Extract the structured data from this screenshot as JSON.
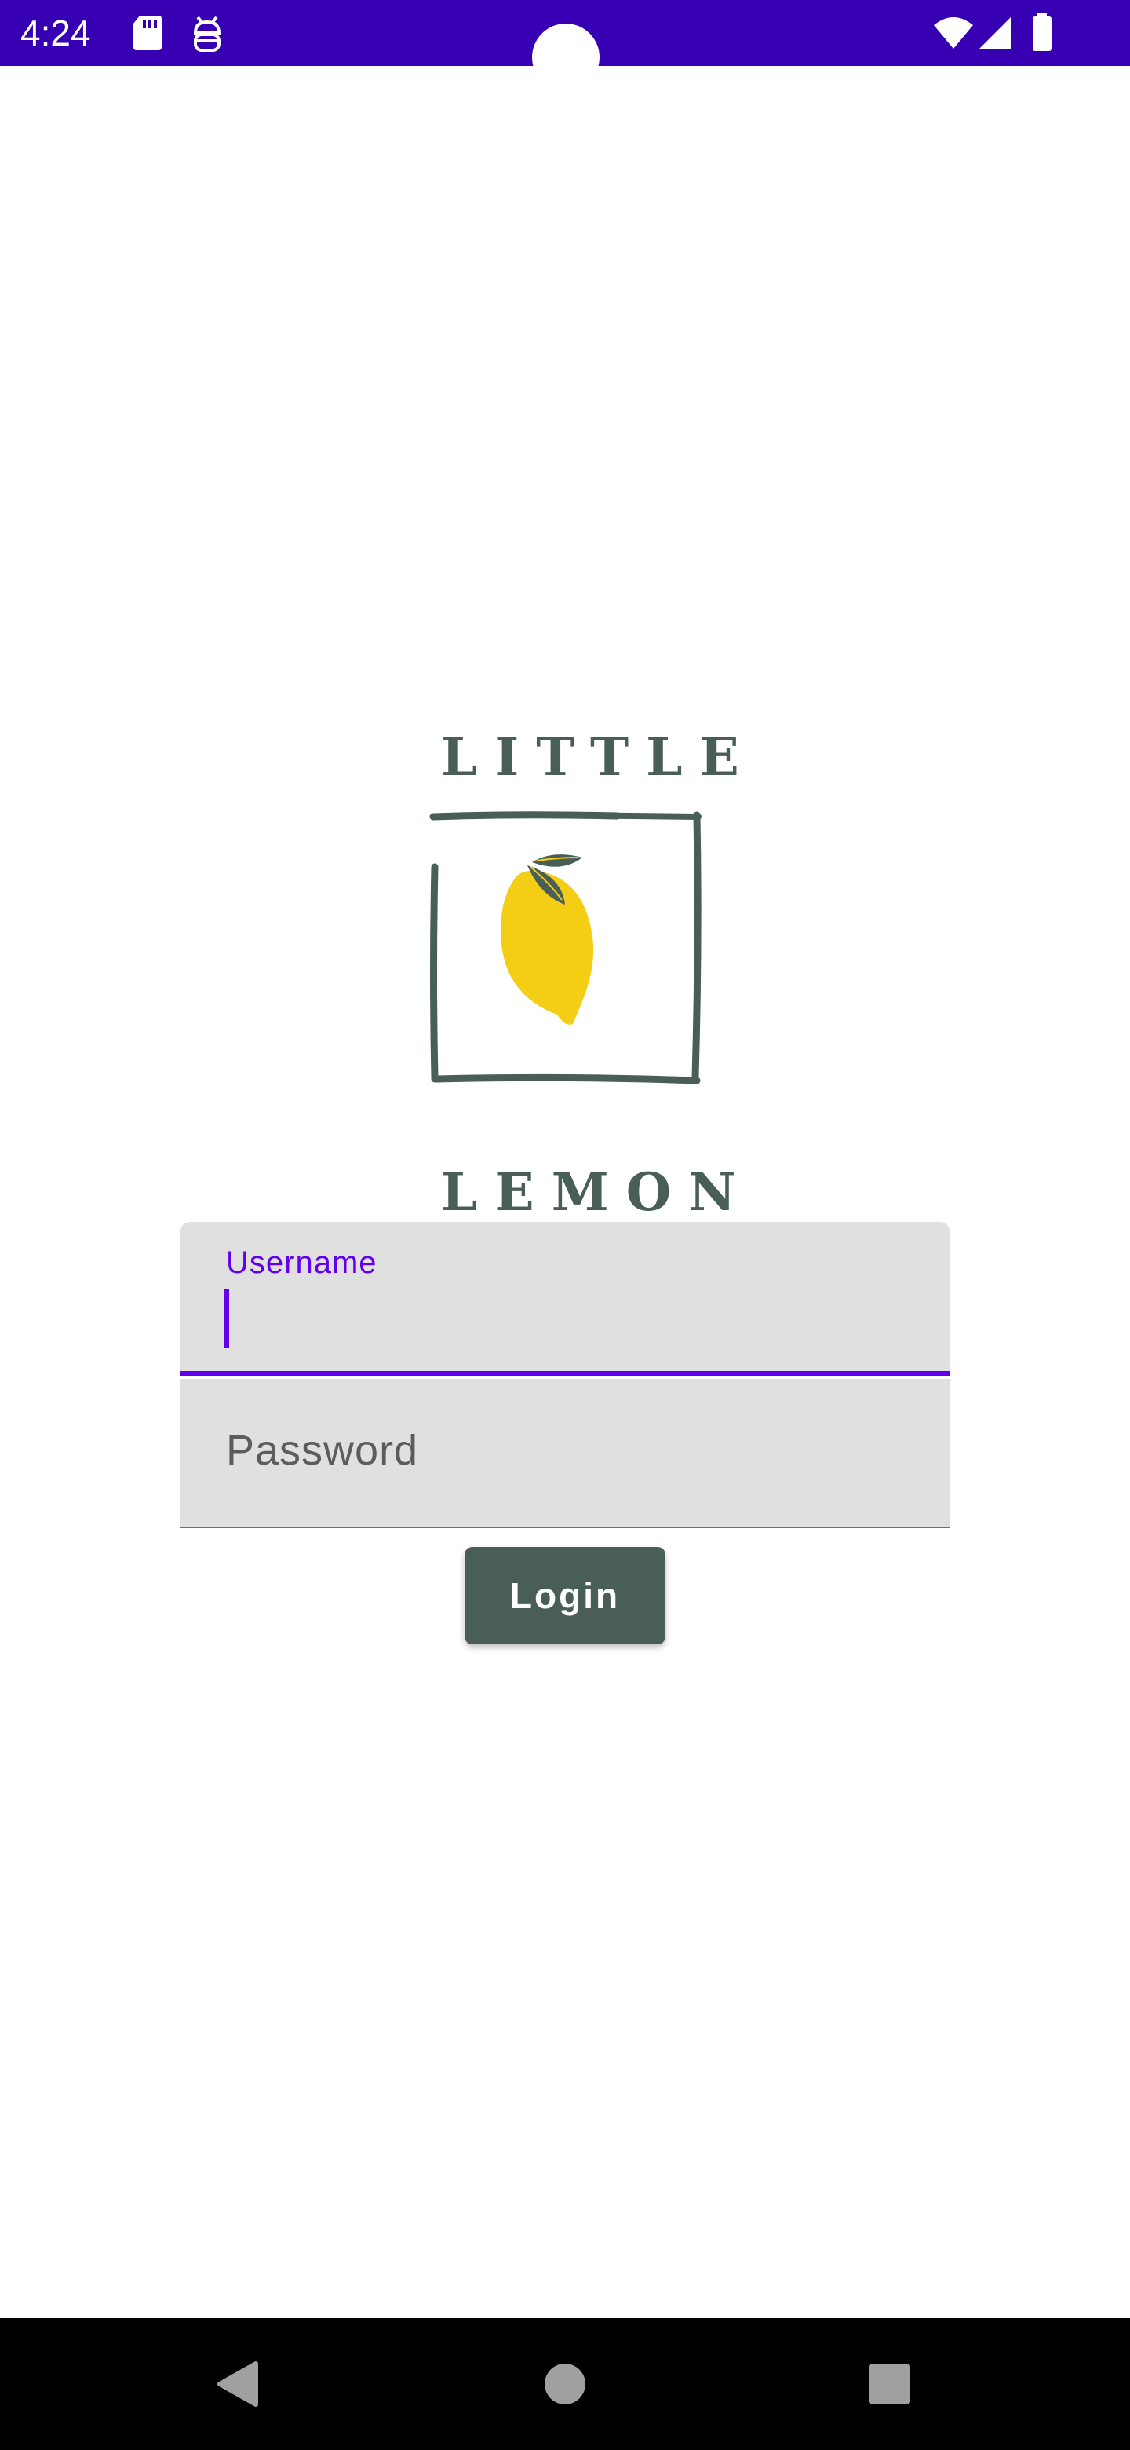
{
  "status_bar": {
    "time": "4:24",
    "icons": [
      "sd-card-icon",
      "debug-robot-icon",
      "wifi-icon",
      "cell-signal-icon",
      "battery-icon"
    ],
    "background_color": "#3700b3"
  },
  "logo": {
    "word_top": "LITTLE",
    "word_bottom": "LEMON",
    "icon": "lemon-icon",
    "text_color": "#495e57",
    "lemon_color": "#f4ce14"
  },
  "login_form": {
    "username": {
      "label": "Username",
      "value": "",
      "focused": true
    },
    "password": {
      "placeholder": "Password",
      "value": ""
    },
    "login_label": "Login",
    "accent_color": "#6200ee",
    "button_color": "#495e57"
  },
  "nav_bar": {
    "buttons": [
      "back-icon",
      "home-icon",
      "recents-icon"
    ]
  }
}
